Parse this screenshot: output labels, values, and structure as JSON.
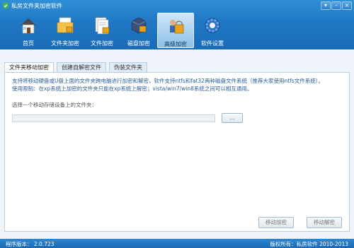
{
  "window": {
    "title": "私房文件夹加密软件",
    "controls": [
      "▾",
      "–",
      "×"
    ]
  },
  "toolbar": {
    "items": [
      {
        "label": "首页",
        "icon": "home-icon"
      },
      {
        "label": "文件夹加密",
        "icon": "folder-encrypt-icon"
      },
      {
        "label": "文件加密",
        "icon": "file-encrypt-icon"
      },
      {
        "label": "磁盘加密",
        "icon": "disk-encrypt-icon"
      },
      {
        "label": "高级加密",
        "icon": "advanced-encrypt-icon",
        "active": true
      },
      {
        "label": "软件设置",
        "icon": "gear-icon"
      }
    ]
  },
  "tabs": [
    {
      "label": "文件夹移动加密",
      "active": true
    },
    {
      "label": "创建自解密文件"
    },
    {
      "label": "伪装文件夹"
    }
  ],
  "panel": {
    "description_line1": "支持将移动硬盘或U盘上面的文件夹跨电脑进行加密和解密，软件支持ntfs和fat32两种磁盘文件系统（推荐大家使用ntfs文件系统）。",
    "description_line2": "使用限制：在xp系统上加密的文件夹只能在xp系统上解密；vista/win7/win8系统之间可以相互通用。",
    "folder_label": "选择一个移动存储设备上的文件夹：",
    "path_value": "",
    "browse_label": "...",
    "encrypt_label": "移动加密",
    "decrypt_label": "移动解密"
  },
  "status": {
    "version": "程序版本：  2.0.723",
    "copyright": "版权所有：私房软件 2010-2013"
  },
  "colors": {
    "banner": "#1f78c5",
    "panel_text": "#2a5c9a",
    "status_bar": "#1a6ab5"
  }
}
